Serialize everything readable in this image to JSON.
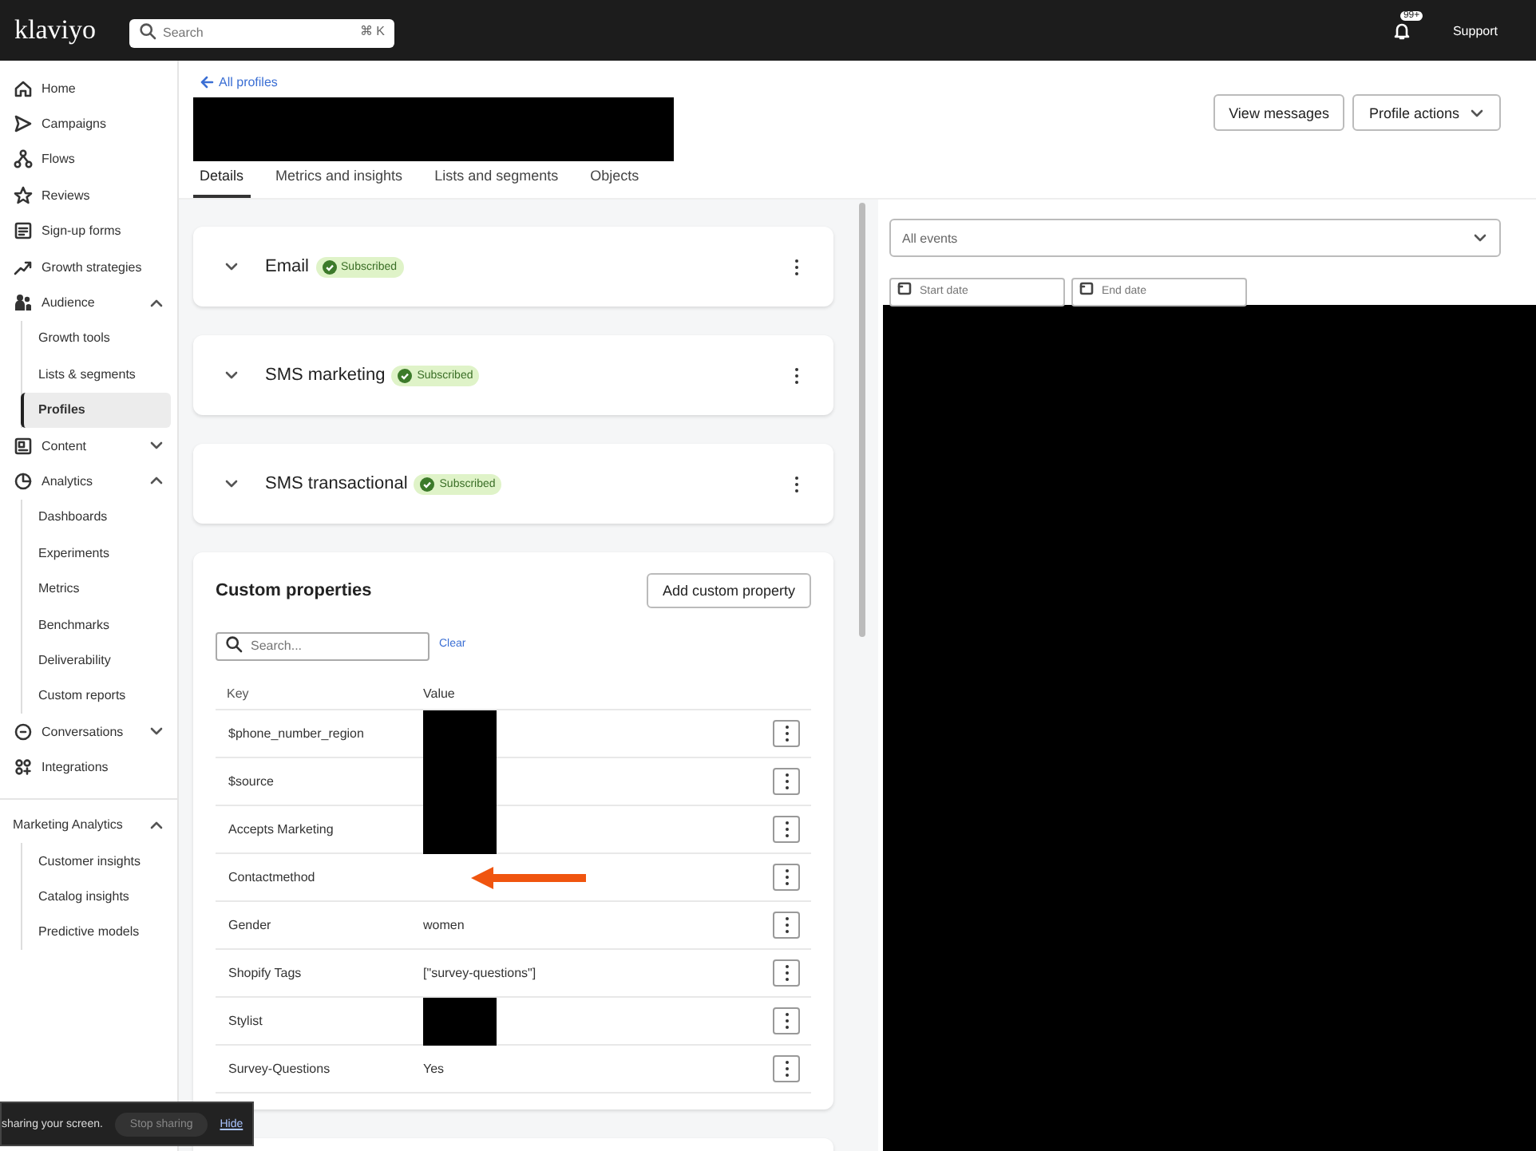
{
  "topbar": {
    "logo": "klaviyo",
    "search": {
      "placeholder": "Search",
      "shortcut": "⌘ K"
    },
    "notifications_badge": "99+",
    "support": "Support"
  },
  "sidebar": {
    "items": [
      {
        "label": "Home",
        "selected": false
      },
      {
        "label": "Campaigns",
        "selected": false
      },
      {
        "label": "Flows",
        "selected": false
      },
      {
        "label": "Reviews",
        "selected": false
      },
      {
        "label": "Sign-up forms",
        "selected": false
      },
      {
        "label": "Growth strategies",
        "selected": false
      },
      {
        "label": "Audience",
        "selected": false,
        "expanded": true,
        "children": [
          {
            "label": "Growth tools",
            "selected": false
          },
          {
            "label": "Lists & segments",
            "selected": false
          },
          {
            "label": "Profiles",
            "selected": true
          }
        ]
      },
      {
        "label": "Content",
        "selected": false,
        "expanded": false
      },
      {
        "label": "Analytics",
        "selected": false,
        "expanded": true,
        "children": [
          {
            "label": "Dashboards",
            "selected": false
          },
          {
            "label": "Experiments",
            "selected": false
          },
          {
            "label": "Metrics",
            "selected": false
          },
          {
            "label": "Benchmarks",
            "selected": false
          },
          {
            "label": "Deliverability",
            "selected": false
          },
          {
            "label": "Custom reports",
            "selected": false
          }
        ]
      },
      {
        "label": "Conversations",
        "selected": false,
        "expanded": false
      },
      {
        "label": "Integrations",
        "selected": false
      }
    ],
    "section": {
      "label": "Marketing Analytics",
      "expanded": true,
      "children": [
        {
          "label": "Customer insights",
          "selected": false
        },
        {
          "label": "Catalog insights",
          "selected": false
        },
        {
          "label": "Predictive models",
          "selected": false
        }
      ]
    }
  },
  "header": {
    "back_link": "All profiles",
    "name_redacted": true,
    "buttons": [
      {
        "label": "View messages",
        "dropdown": false
      },
      {
        "label": "Profile actions",
        "dropdown": true
      }
    ],
    "tabs": [
      {
        "label": "Details",
        "selected": true
      },
      {
        "label": "Metrics and insights",
        "selected": false
      },
      {
        "label": "Lists and segments",
        "selected": false
      },
      {
        "label": "Objects",
        "selected": false
      }
    ]
  },
  "channels": [
    {
      "name": "Email",
      "status": "Subscribed"
    },
    {
      "name": "SMS marketing",
      "status": "Subscribed"
    },
    {
      "name": "SMS transactional",
      "status": "Subscribed"
    }
  ],
  "custom_properties": {
    "title": "Custom properties",
    "add_button": "Add custom property",
    "search": {
      "placeholder": "Search..."
    },
    "clear": "Clear",
    "columns": [
      "Key",
      "Value"
    ],
    "rows": [
      {
        "key": "$phone_number_region",
        "redacted": true,
        "annotated": false
      },
      {
        "key": "$source",
        "redacted": true,
        "annotated": false
      },
      {
        "key": "Accepts Marketing",
        "redacted": true,
        "annotated": false
      },
      {
        "key": "Contactmethod",
        "redacted": false,
        "annotated": true
      },
      {
        "key": "Gender",
        "value": "women",
        "redacted": false,
        "annotated": false
      },
      {
        "key": "Shopify Tags",
        "value": "[\"survey-questions\"]",
        "redacted": false,
        "annotated": false
      },
      {
        "key": "Stylist",
        "redacted": true,
        "annotated": false
      },
      {
        "key": "Survey-Questions",
        "value": "Yes",
        "redacted": false,
        "annotated": false
      }
    ]
  },
  "activity": {
    "events_select": "All events",
    "start_date": {
      "placeholder": "Start date"
    },
    "end_date": {
      "placeholder": "End date"
    },
    "redacted": true
  },
  "share_bar": {
    "message": "sharing your screen.",
    "stop": "Stop sharing",
    "hide": "Hide"
  }
}
